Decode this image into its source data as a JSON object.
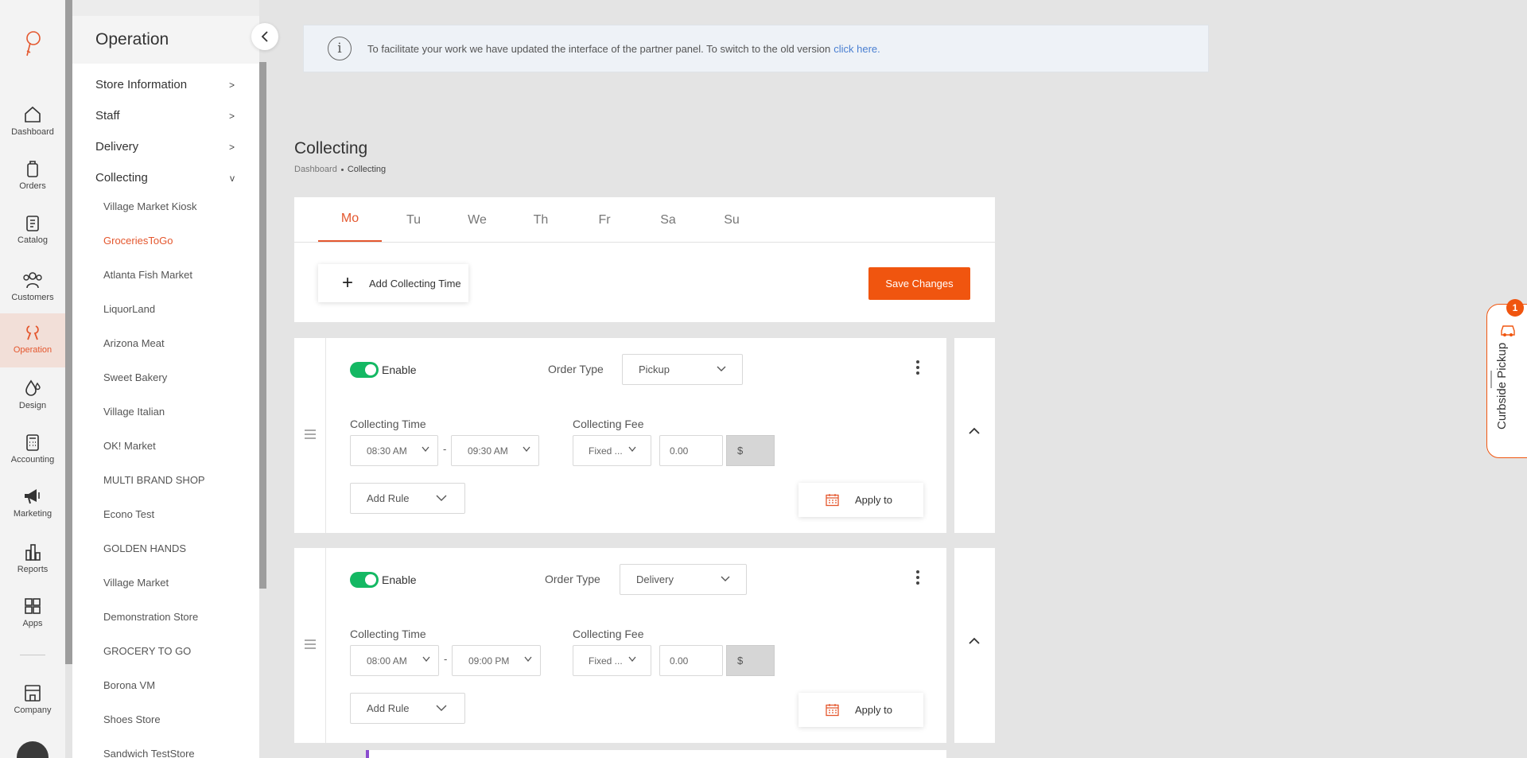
{
  "rail": {
    "items": [
      {
        "label": "Dashboard",
        "icon": "home-icon"
      },
      {
        "label": "Orders",
        "icon": "bag-icon"
      },
      {
        "label": "Catalog",
        "icon": "clipboard-icon"
      },
      {
        "label": "Customers",
        "icon": "users-icon"
      },
      {
        "label": "Operation",
        "icon": "operation-icon",
        "active": true
      },
      {
        "label": "Design",
        "icon": "drops-icon"
      },
      {
        "label": "Accounting",
        "icon": "calculator-icon"
      },
      {
        "label": "Marketing",
        "icon": "megaphone-icon"
      },
      {
        "label": "Reports",
        "icon": "bar-chart-icon"
      },
      {
        "label": "Apps",
        "icon": "apps-grid-icon"
      },
      {
        "label": "Company",
        "icon": "store-icon"
      }
    ]
  },
  "sidebar": {
    "title": "Operation",
    "sections": [
      {
        "label": "Store Information",
        "chevron": ">"
      },
      {
        "label": "Staff",
        "chevron": ">"
      },
      {
        "label": "Delivery",
        "chevron": ">"
      },
      {
        "label": "Collecting",
        "chevron": "v"
      }
    ],
    "stores": [
      "Village Market Kiosk",
      "GroceriesToGo",
      "Atlanta Fish Market",
      "LiquorLand",
      "Arizona Meat",
      "Sweet Bakery",
      "Village Italian",
      "OK! Market",
      "MULTI BRAND SHOP",
      "Econo Test",
      "GOLDEN HANDS",
      "Village Market",
      "Demonstration Store",
      "GROCERY TO GO",
      "Borona VM",
      "Shoes Store",
      "Sandwich TestStore"
    ],
    "active_store": "GroceriesToGo"
  },
  "notice": {
    "text": "To facilitate your work we have updated the interface of the partner panel. To switch to the old version",
    "link": "click here."
  },
  "page": {
    "title": "Collecting",
    "breadcrumb": [
      "Dashboard",
      "Collecting"
    ]
  },
  "days": {
    "items": [
      "Mo",
      "Tu",
      "We",
      "Th",
      "Fr",
      "Sa",
      "Su"
    ],
    "active": "Mo"
  },
  "actions": {
    "add_time": "Add Collecting Time",
    "save": "Save Changes"
  },
  "rules": [
    {
      "enable_label": "Enable",
      "order_type_label": "Order Type",
      "order_type": "Pickup",
      "time_label": "Collecting Time",
      "start": "08:30 AM",
      "end": "09:30 AM",
      "fee_label": "Collecting Fee",
      "fee_type": "Fixed ...",
      "fee_value": "0.00",
      "currency": "$",
      "add_rule": "Add Rule",
      "apply": "Apply to"
    },
    {
      "enable_label": "Enable",
      "order_type_label": "Order Type",
      "order_type": "Delivery",
      "time_label": "Collecting Time",
      "start": "08:00 AM",
      "end": "09:00 PM",
      "fee_label": "Collecting Fee",
      "fee_type": "Fixed ...",
      "fee_value": "0.00",
      "currency": "$",
      "add_rule": "Add Rule",
      "apply": "Apply to"
    }
  ],
  "curbside": {
    "label": "Curbside Pickup",
    "badge": "1"
  },
  "colors": {
    "accent": "#f0550f",
    "toggle_on": "#14b863",
    "link": "#4a7fd1"
  }
}
